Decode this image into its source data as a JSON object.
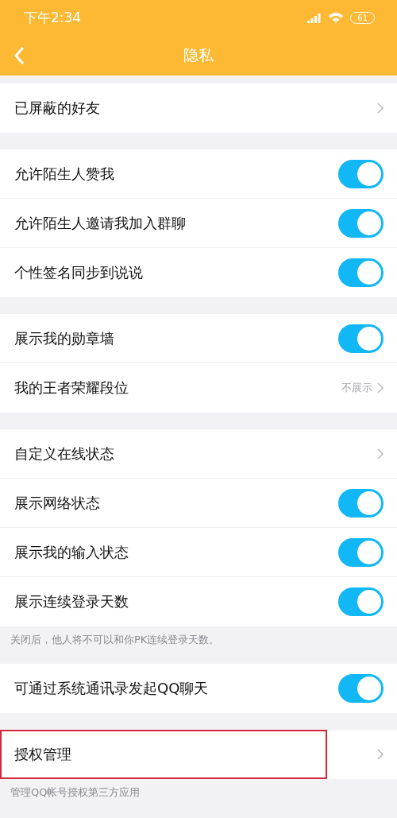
{
  "status_bar": {
    "time": "下午2:34",
    "battery": "61"
  },
  "nav_bar": {
    "title": "隐私"
  },
  "sections": [
    {
      "items": [
        {
          "kind": "link",
          "label": "已屏蔽的好友"
        }
      ]
    },
    {
      "items": [
        {
          "kind": "toggle",
          "label": "允许陌生人赞我",
          "on": true
        },
        {
          "kind": "toggle",
          "label": "允许陌生人邀请我加入群聊",
          "on": true
        },
        {
          "kind": "toggle",
          "label": "个性签名同步到说说",
          "on": true
        }
      ]
    },
    {
      "items": [
        {
          "kind": "toggle",
          "label": "展示我的勋章墙",
          "on": true
        },
        {
          "kind": "link",
          "label": "我的王者荣耀段位",
          "value": "不展示"
        }
      ]
    },
    {
      "items": [
        {
          "kind": "link",
          "label": "自定义在线状态"
        },
        {
          "kind": "toggle",
          "label": "展示网络状态",
          "on": true
        },
        {
          "kind": "toggle",
          "label": "展示我的输入状态",
          "on": true
        },
        {
          "kind": "toggle",
          "label": "展示连续登录天数",
          "on": true
        }
      ],
      "note": "关闭后，他人将不可以和你PK连续登录天数。"
    },
    {
      "items": [
        {
          "kind": "toggle",
          "label": "可通过系统通讯录发起QQ聊天",
          "on": true
        }
      ]
    },
    {
      "items": [
        {
          "kind": "link",
          "label": "授权管理",
          "highlighted": true
        }
      ],
      "note": "管理QQ帐号授权第三方应用"
    }
  ]
}
